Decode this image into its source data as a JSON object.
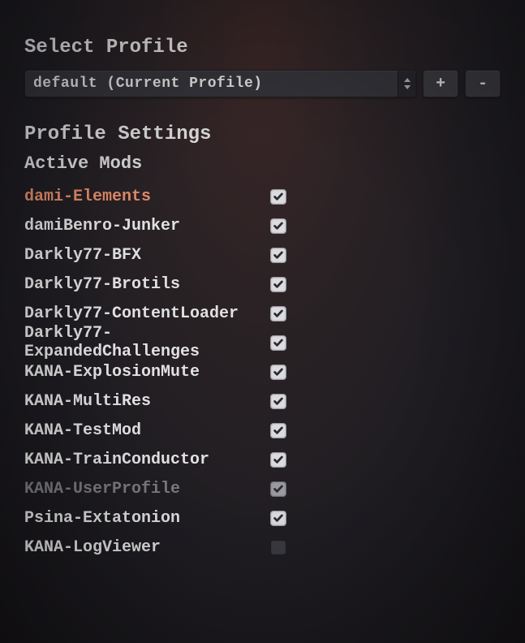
{
  "select_profile": {
    "title": "Select Profile",
    "value": "default (Current Profile)",
    "add_label": "+",
    "remove_label": "-"
  },
  "profile_settings": {
    "title": "Profile Settings",
    "active_mods_title": "Active Mods"
  },
  "mods": [
    {
      "name": "dami-Elements",
      "checked": true,
      "state": "highlight"
    },
    {
      "name": "damiBenro-Junker",
      "checked": true,
      "state": "normal"
    },
    {
      "name": "Darkly77-BFX",
      "checked": true,
      "state": "normal"
    },
    {
      "name": "Darkly77-Brotils",
      "checked": true,
      "state": "normal"
    },
    {
      "name": "Darkly77-ContentLoader",
      "checked": true,
      "state": "normal"
    },
    {
      "name": "Darkly77-ExpandedChallenges",
      "checked": true,
      "state": "normal"
    },
    {
      "name": "KANA-ExplosionMute",
      "checked": true,
      "state": "normal"
    },
    {
      "name": "KANA-MultiRes",
      "checked": true,
      "state": "normal"
    },
    {
      "name": "KANA-TestMod",
      "checked": true,
      "state": "normal"
    },
    {
      "name": "KANA-TrainConductor",
      "checked": true,
      "state": "normal"
    },
    {
      "name": "KANA-UserProfile",
      "checked": true,
      "state": "dim"
    },
    {
      "name": "Psina-Extatonion",
      "checked": true,
      "state": "normal"
    },
    {
      "name": "KANA-LogViewer",
      "checked": false,
      "state": "normal"
    }
  ]
}
